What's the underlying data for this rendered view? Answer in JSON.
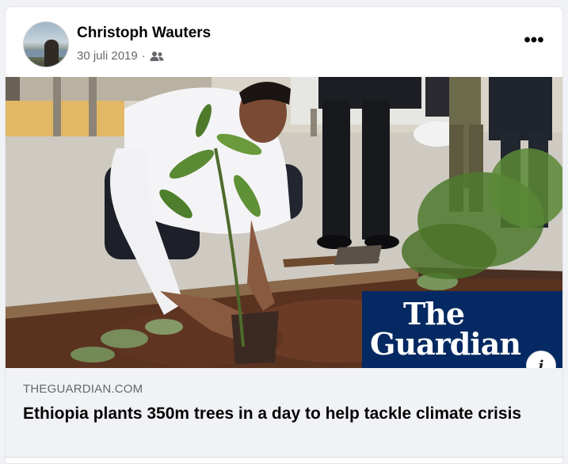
{
  "post": {
    "author": "Christoph Wauters",
    "date": "30 juli 2019",
    "separator": "·",
    "audience_icon": "friends-icon",
    "more_label": "•••"
  },
  "link_preview": {
    "publisher_logo_line1": "The",
    "publisher_logo_line2": "Guardian",
    "info_icon_label": "i",
    "domain": "THEGUARDIAN.COM",
    "title": "Ethiopia plants 350m trees in a day to help tackle climate crisis"
  },
  "colors": {
    "guardian_blue": "#052962",
    "secondary_text": "#65676b",
    "primary_text": "#050505",
    "footer_bg": "#f0f2f5"
  }
}
